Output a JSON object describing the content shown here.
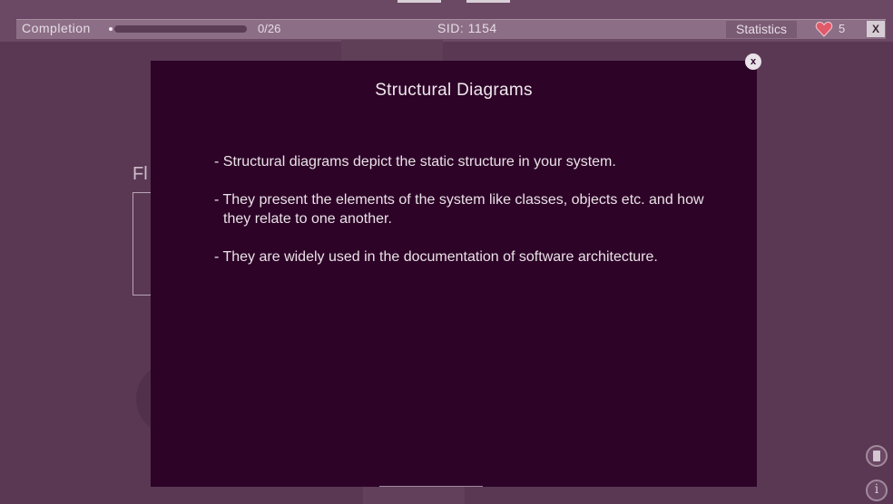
{
  "topbar": {
    "completion_label": "Completion",
    "progress_value": 0,
    "progress_total": 26,
    "progress_text": "0/26",
    "sid_text": "SID: 1154",
    "statistics_label": "Statistics",
    "lives": "5",
    "close_label": "X"
  },
  "background": {
    "heading_fragment": "Fl"
  },
  "modal": {
    "close_label": "x",
    "title": "Structural Diagrams",
    "bullets": [
      "- Structural diagrams depict the static structure in your system.",
      "- They present the elements of the system like classes, objects etc. and how they relate to one another.",
      "- They are widely used in the documentation of software architecture."
    ]
  },
  "side_icons": {
    "doc_icon": "document-icon",
    "info_icon": "info-icon",
    "info_glyph": "i"
  }
}
